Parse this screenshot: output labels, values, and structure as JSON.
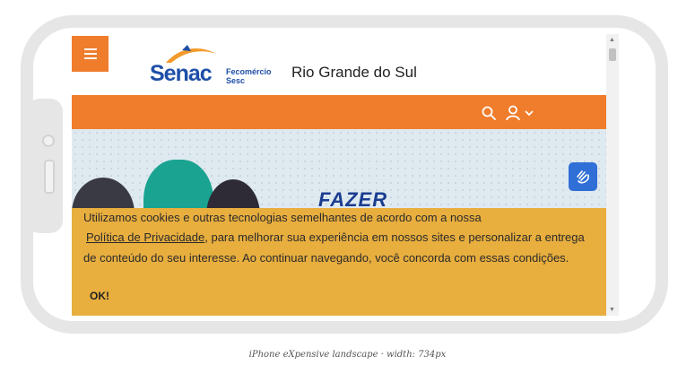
{
  "header": {
    "menu_icon": "hamburger-icon",
    "logo_brand": "Senac",
    "logo_partner": "Fecomércio Sesc",
    "region_title": "Rio Grande do Sul"
  },
  "toolbar": {
    "search_icon": "search-icon",
    "user_icon": "user-icon",
    "dropdown_icon": "chevron-down-icon",
    "bar_color": "#ef7d2c"
  },
  "banner": {
    "text": "FAZER"
  },
  "accessibility": {
    "icon": "sign-language-icon",
    "color": "#2f6fd6"
  },
  "cookie_notice": {
    "line1": "Utilizamos cookies e outras tecnologias semelhantes de acordo com a nossa",
    "link_text": "Política de Privacidade",
    "line2_rest": ", para melhorar sua experiência em nossos sites e personalizar a entrega",
    "line3": "de conteúdo do seu interesse. Ao continuar navegando, você concorda com essas condições.",
    "ok_label": "OK!",
    "background": "#e8ae3e"
  },
  "caption": "iPhone eXpensive landscape · width: 734px"
}
